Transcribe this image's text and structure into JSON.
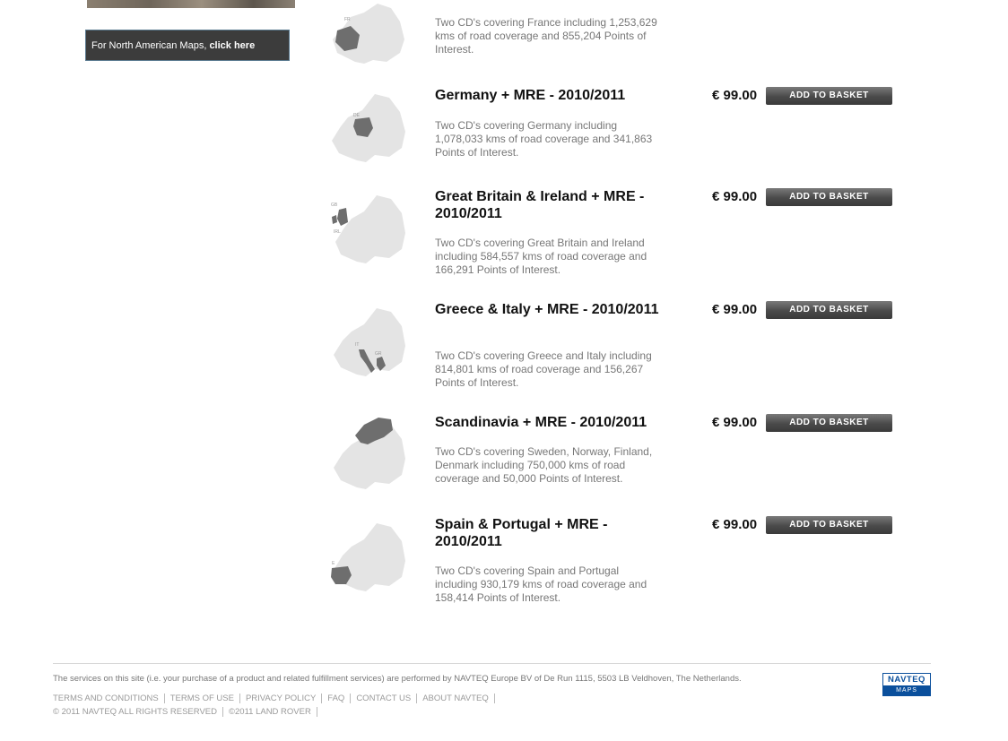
{
  "sidebar": {
    "na_text": "For North American Maps, ",
    "na_link": "click here"
  },
  "products": [
    {
      "title": "",
      "desc": "Two CD's covering France including 1,253,629 kms of road coverage and 855,204 Points of Interest.",
      "map_label": "FR",
      "price": "",
      "button": ""
    },
    {
      "title": "Germany + MRE - 2010/2011",
      "desc": "Two CD's covering Germany including 1,078,033 kms of road coverage and 341,863 Points of Interest.",
      "map_label": "DE",
      "price": "€ 99.00",
      "button": "ADD TO BASKET"
    },
    {
      "title": "Great Britain & Ireland + MRE - 2010/2011",
      "desc": "Two CD's covering Great Britain and Ireland including 584,557 kms of road coverage and 166,291 Points of Interest.",
      "map_label": "GB",
      "map_label2": "IRL",
      "price": "€ 99.00",
      "button": "ADD TO BASKET"
    },
    {
      "title": "Greece & Italy + MRE - 2010/2011",
      "desc": "Two CD's covering Greece and Italy including 814,801 kms of road coverage and 156,267 Points of Interest.",
      "map_label": "IT",
      "map_label2": "GR",
      "price": "€ 99.00",
      "button": "ADD TO BASKET"
    },
    {
      "title": "Scandinavia + MRE - 2010/2011",
      "desc": "Two CD's covering Sweden, Norway, Finland, Denmark including 750,000 kms of road coverage and 50,000 Points of Interest.",
      "price": "€ 99.00",
      "button": "ADD TO BASKET"
    },
    {
      "title": "Spain & Portugal + MRE - 2010/2011",
      "desc": "Two CD's covering Spain and Portugal including 930,179 kms of road coverage and 158,414 Points of Interest.",
      "map_label": "E",
      "price": "€ 99.00",
      "button": "ADD TO BASKET"
    }
  ],
  "footer": {
    "notice": "The services on this site (i.e. your purchase of a product and related fulfillment services) are performed by NAVTEQ Europe BV of De Run 1115, 5503 LB Veldhoven, The Netherlands.",
    "links": [
      "TERMS AND CONDITIONS",
      "TERMS OF USE",
      "PRIVACY POLICY",
      "FAQ",
      "CONTACT US",
      "ABOUT NAVTEQ"
    ],
    "copyright": "© 2011 NAVTEQ ALL RIGHTS RESERVED",
    "copyright2": "©2011 LAND ROVER",
    "logo_top": "NAVTEQ",
    "logo_bottom": "MAPS"
  }
}
